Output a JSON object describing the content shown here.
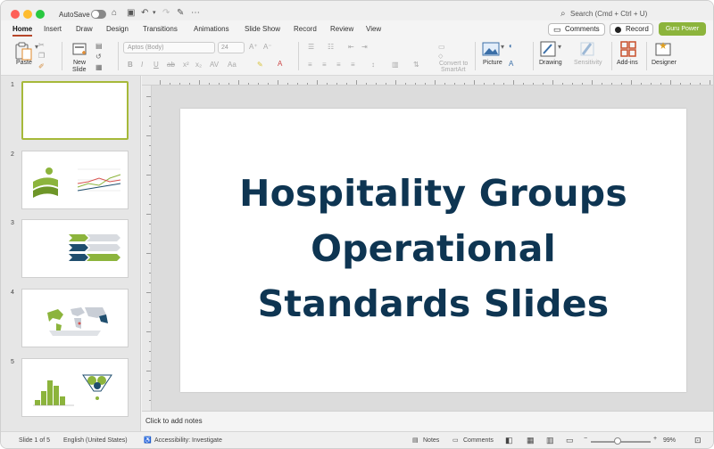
{
  "titlebar": {
    "autosave_label": "AutoSave",
    "search_placeholder": "Search (Cmd + Ctrl + U)"
  },
  "menu": {
    "tabs": [
      "Home",
      "Insert",
      "Draw",
      "Design",
      "Transitions",
      "Animations",
      "Slide Show",
      "Record",
      "Review",
      "View"
    ],
    "comments_label": "Comments",
    "record_label": "Record",
    "guru_label": "Guru Power"
  },
  "ribbon": {
    "paste": "Paste",
    "new_slide_line1": "New",
    "new_slide_line2": "Slide",
    "font_name": "Aptos (Body)",
    "font_size": "24",
    "convert_line1": "Convert to",
    "convert_line2": "SmartArt",
    "picture": "Picture",
    "drawing": "Drawing",
    "sensitivity": "Sensitivity",
    "addins": "Add-ins",
    "designer": "Designer"
  },
  "slides": {
    "numbers": [
      "1",
      "2",
      "3",
      "4",
      "5"
    ]
  },
  "slide": {
    "title": "Hospitality Groups Operational Standards Slides"
  },
  "notes": {
    "placeholder": "Click to add notes"
  },
  "status": {
    "slide_of": "Slide 1 of 5",
    "language": "English (United States)",
    "accessibility": "Accessibility: Investigate",
    "notes": "Notes",
    "comments": "Comments",
    "zoom": "99%"
  },
  "colors": {
    "accent_green": "#8cb43c",
    "title_navy": "#0e3552",
    "active_tab": "#b7472a"
  }
}
